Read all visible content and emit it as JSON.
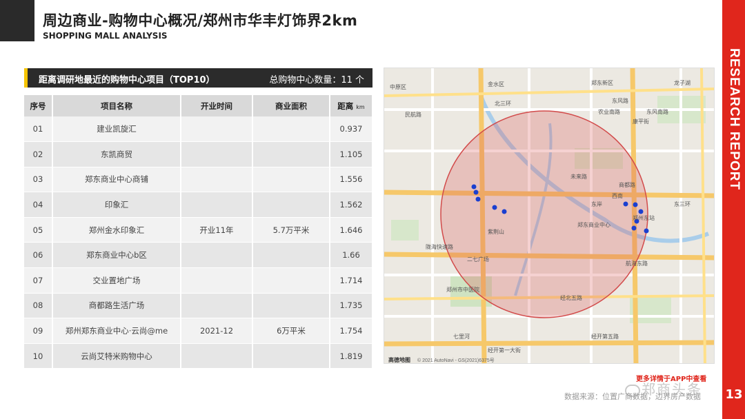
{
  "header": {
    "title": "周边商业-购物中心概况/郑州市华丰灯饰界2km",
    "subtitle": "SHOPPING MALL ANALYSIS"
  },
  "side": {
    "band_text": "RESEARCH REPORT",
    "page_number": "13"
  },
  "table_header": {
    "left": "距离调研地最近的购物中心项目（TOP10）",
    "right": "总购物中心数量：11 个"
  },
  "table": {
    "columns": [
      "序号",
      "项目名称",
      "开业时间",
      "商业面积",
      "距离"
    ],
    "distance_unit": "km",
    "rows": [
      [
        "01",
        "建业凯旋汇",
        "",
        "",
        "0.937"
      ],
      [
        "02",
        "东凯商贸",
        "",
        "",
        "1.105"
      ],
      [
        "03",
        "郑东商业中心商铺",
        "",
        "",
        "1.556"
      ],
      [
        "04",
        "印象汇",
        "",
        "",
        "1.562"
      ],
      [
        "05",
        "郑州金水印象汇",
        "开业11年",
        "5.7万平米",
        "1.646"
      ],
      [
        "06",
        "郑东商业中心b区",
        "",
        "",
        "1.66"
      ],
      [
        "07",
        "交业置地广场",
        "",
        "",
        "1.714"
      ],
      [
        "08",
        "商都路生活广场",
        "",
        "",
        "1.735"
      ],
      [
        "09",
        "郑州郑东商业中心·云尚@me",
        "2021-12",
        "6万平米",
        "1.754"
      ],
      [
        "10",
        "云尚艾特米购物中心",
        "",
        "",
        "1.819"
      ]
    ]
  },
  "map": {
    "labels": [
      "中原区",
      "金水区",
      "郑东新区",
      "龙子湖",
      "民航路",
      "北三环",
      "东风路",
      "农业南路",
      "康平街",
      "东风南路",
      "商都路",
      "紫荆山",
      "未来路",
      "陇海快速路",
      "郑州市中医院",
      "二七广场",
      "经北五路",
      "东三环",
      "七里河",
      "经开第五路",
      "航海东路",
      "经开第一大街",
      "郑州东站",
      "西南",
      "东岸",
      "郑东商业中心"
    ],
    "attribution": "© 2021 AutoNavi - GS(2021)6375号",
    "logo": "高德地图"
  },
  "footer": {
    "app_note": "更多详情于APP中查看",
    "source": "数据来源：位置广商数据，边界房产数据",
    "watermark": "郑商头条"
  }
}
